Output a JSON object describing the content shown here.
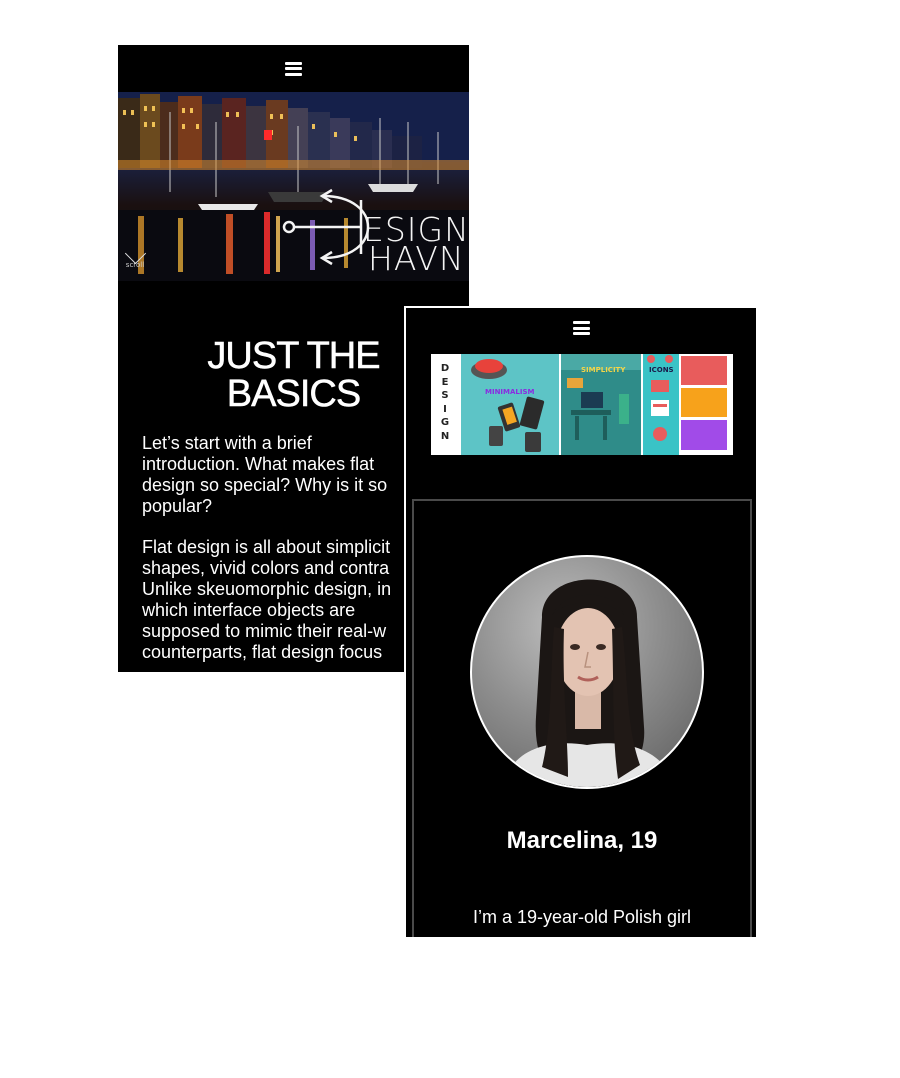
{
  "screen1": {
    "nav": {
      "menu_icon": "hamburger-menu-icon"
    },
    "hero": {
      "logo_line1": "ESIGN",
      "logo_line2": "HAVN",
      "logo_icon": "anchor-d-icon",
      "scroll_label": "scroll",
      "scroll_icon": "chevron-down-icon"
    },
    "section": {
      "title_line1": "JUST THE",
      "title_line2": "BASICS",
      "paragraph1": "Let’s start with a brief\nintroduction. What makes flat\ndesign so special? Why is it so\npopular?",
      "paragraph2": "Flat design is all about simplicit\nshapes, vivid colors and contra\nUnlike skeuomorphic design, in\nwhich interface objects are\nsupposed to mimic their real-w\ncounterparts, flat design focus"
    }
  },
  "screen2": {
    "nav": {
      "menu_icon": "hamburger-menu-icon"
    },
    "banner": {
      "vertical_letters": [
        "D",
        "E",
        "S",
        "I",
        "G",
        "N"
      ],
      "label_minimalism": "MINIMALISM",
      "label_simplicity": "SIMPLICITY",
      "label_icons": "ICONS",
      "swatches": [
        "#e85c5c",
        "#f7a21b",
        "#a14be8"
      ]
    },
    "profile": {
      "name": "Marcelina, 19",
      "bio": "I’m a 19-year-old Polish girl"
    }
  },
  "colors": {
    "background": "#ffffff",
    "screen": "#000000",
    "text": "#ffffff",
    "card_border": "#4a4a4a"
  }
}
